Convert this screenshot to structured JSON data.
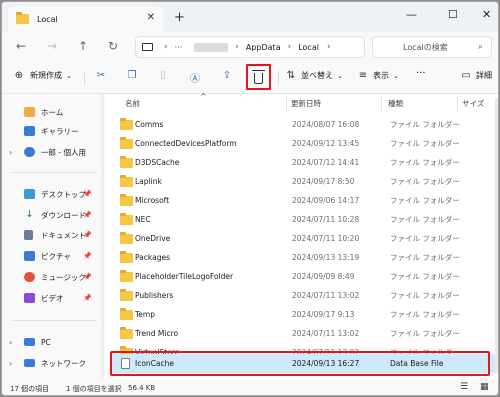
{
  "window": {
    "tab_title": "Local",
    "close_tab": "✕",
    "new_tab": "+",
    "minimize": "—",
    "maximize": "☐",
    "close": "✕"
  },
  "addressbar": {
    "breadcrumbs": [
      "AppData",
      "Local"
    ],
    "more": "···",
    "search_placeholder": "Localの検索",
    "search_icon": "search-icon"
  },
  "toolbar": {
    "new_label": "新規作成",
    "sort_label": "並べ替え",
    "view_label": "表示",
    "more_label": "···",
    "details_label": "詳細"
  },
  "sidebar": {
    "items": [
      {
        "label": "ホーム",
        "icon": "home-icon",
        "color": "#f4a742"
      },
      {
        "label": "ギャラリー",
        "icon": "gallery-icon",
        "color": "#3a7bd5"
      },
      {
        "label": "一郎 - 個人用",
        "icon": "cloud-icon",
        "color": "#3a7bd5"
      },
      {
        "label": "デスクトップ",
        "icon": "desktop-icon",
        "color": "#3a9ad9"
      },
      {
        "label": "ダウンロード",
        "icon": "download-icon",
        "color": "#2a7a3a"
      },
      {
        "label": "ドキュメント",
        "icon": "documents-icon",
        "color": "#6b7c93"
      },
      {
        "label": "ピクチャ",
        "icon": "pictures-icon",
        "color": "#3a7bd5"
      },
      {
        "label": "ミュージック",
        "icon": "music-icon",
        "color": "#e0533a"
      },
      {
        "label": "ビデオ",
        "icon": "video-icon",
        "color": "#8a4ad9"
      },
      {
        "label": "PC",
        "icon": "pc-icon",
        "color": "#3a7bd5"
      },
      {
        "label": "ネットワーク",
        "icon": "network-icon",
        "color": "#3a7bd5"
      }
    ]
  },
  "columns": {
    "name": "名前",
    "date": "更新日時",
    "type": "種類",
    "size": "サイズ"
  },
  "files": [
    {
      "name": "Comms",
      "date": "2024/08/07 16:08",
      "type": "ファイル フォルダー"
    },
    {
      "name": "ConnectedDevicesPlatform",
      "date": "2024/09/12 13:45",
      "type": "ファイル フォルダー"
    },
    {
      "name": "D3DSCache",
      "date": "2024/07/12 14:41",
      "type": "ファイル フォルダー"
    },
    {
      "name": "Laplink",
      "date": "2024/09/17 8:50",
      "type": "ファイル フォルダー"
    },
    {
      "name": "Microsoft",
      "date": "2024/09/06 14:17",
      "type": "ファイル フォルダー"
    },
    {
      "name": "NEC",
      "date": "2024/07/11 10:28",
      "type": "ファイル フォルダー"
    },
    {
      "name": "OneDrive",
      "date": "2024/07/11 10:20",
      "type": "ファイル フォルダー"
    },
    {
      "name": "Packages",
      "date": "2024/09/13 13:19",
      "type": "ファイル フォルダー"
    },
    {
      "name": "PlaceholderTileLogoFolder",
      "date": "2024/09/09 8:49",
      "type": "ファイル フォルダー"
    },
    {
      "name": "Publishers",
      "date": "2024/07/11 13:02",
      "type": "ファイル フォルダー"
    },
    {
      "name": "Temp",
      "date": "2024/09/17 9:13",
      "type": "ファイル フォルダー"
    },
    {
      "name": "Trend Micro",
      "date": "2024/07/11 13:02",
      "type": "ファイル フォルダー"
    },
    {
      "name": "VirtualStore",
      "date": "2024/07/11 13:02",
      "type": "ファイル フォルダー"
    },
    {
      "name": "IconCache",
      "date": "2024/09/13 16:27",
      "type": "Data Base File",
      "selected": true
    }
  ],
  "status": {
    "count": "17 個の項目",
    "selection": "1 個の項目を選択",
    "size": "56.4 KB"
  },
  "colors": {
    "highlight": "#e0181e",
    "selection": "#cde8ff",
    "folder": "#f4c842"
  }
}
